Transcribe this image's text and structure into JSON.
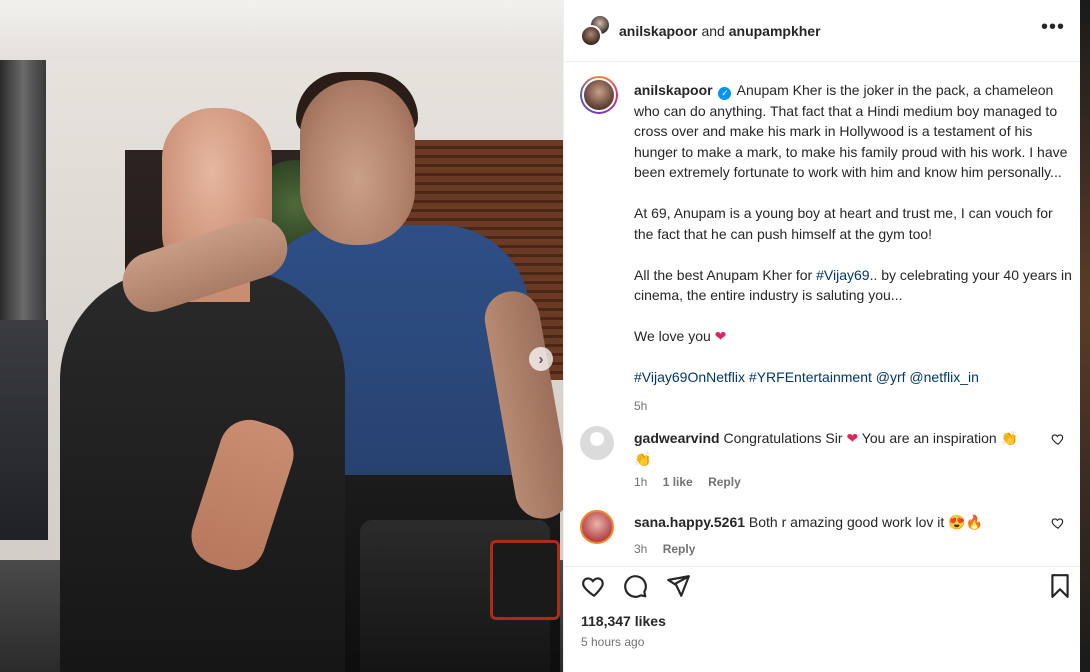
{
  "header": {
    "title_user1": "anilskapoor",
    "title_and": "and",
    "title_user2": "anupampkher",
    "more_icon": "more-horizontal-icon"
  },
  "caption": {
    "username": "anilskapoor",
    "verified_icon": "verified-badge-icon",
    "p1": "Anupam Kher is the joker in the pack, a chameleon who can do anything. That fact that a Hindi medium boy managed to cross over and make his mark in Hollywood is a testament of his hunger to make a mark, to make his family proud with his work. I have been extremely fortunate to work with him and know him personally...",
    "p2": "At 69, Anupam is a young boy at heart and trust me, I can vouch for the fact that he can push himself at the gym too!",
    "p3_before": "All the best Anupam Kher for ",
    "p3_tag": "#Vijay69",
    "p3_after": ".. by celebrating your 40 years in cinema, the entire industry is saluting you...",
    "p4": "We love you",
    "p4_emoji": "❤",
    "tags": [
      "#Vijay69OnNetflix",
      "#YRFEntertainment",
      "@yrf",
      "@netflix_in"
    ],
    "time": "5h"
  },
  "comments": [
    {
      "username": "gadwearvind",
      "text_before": "Congratulations Sir ",
      "emoji1": "❤",
      "text_after": " You are an inspiration 👏",
      "line2": "👏",
      "time": "1h",
      "likes": "1 like",
      "reply": "Reply"
    },
    {
      "username": "sana.happy.5261",
      "text": "Both r amazing good work lov it 😍🔥",
      "time": "3h",
      "reply": "Reply"
    }
  ],
  "actions": {
    "like_icon": "heart-icon",
    "comment_icon": "comment-icon",
    "share_icon": "share-icon",
    "save_icon": "bookmark-icon"
  },
  "likes": "118,347 likes",
  "posted": "5 hours ago",
  "carousel": {
    "next_icon": "chevron-right-icon",
    "next_glyph": "›"
  }
}
